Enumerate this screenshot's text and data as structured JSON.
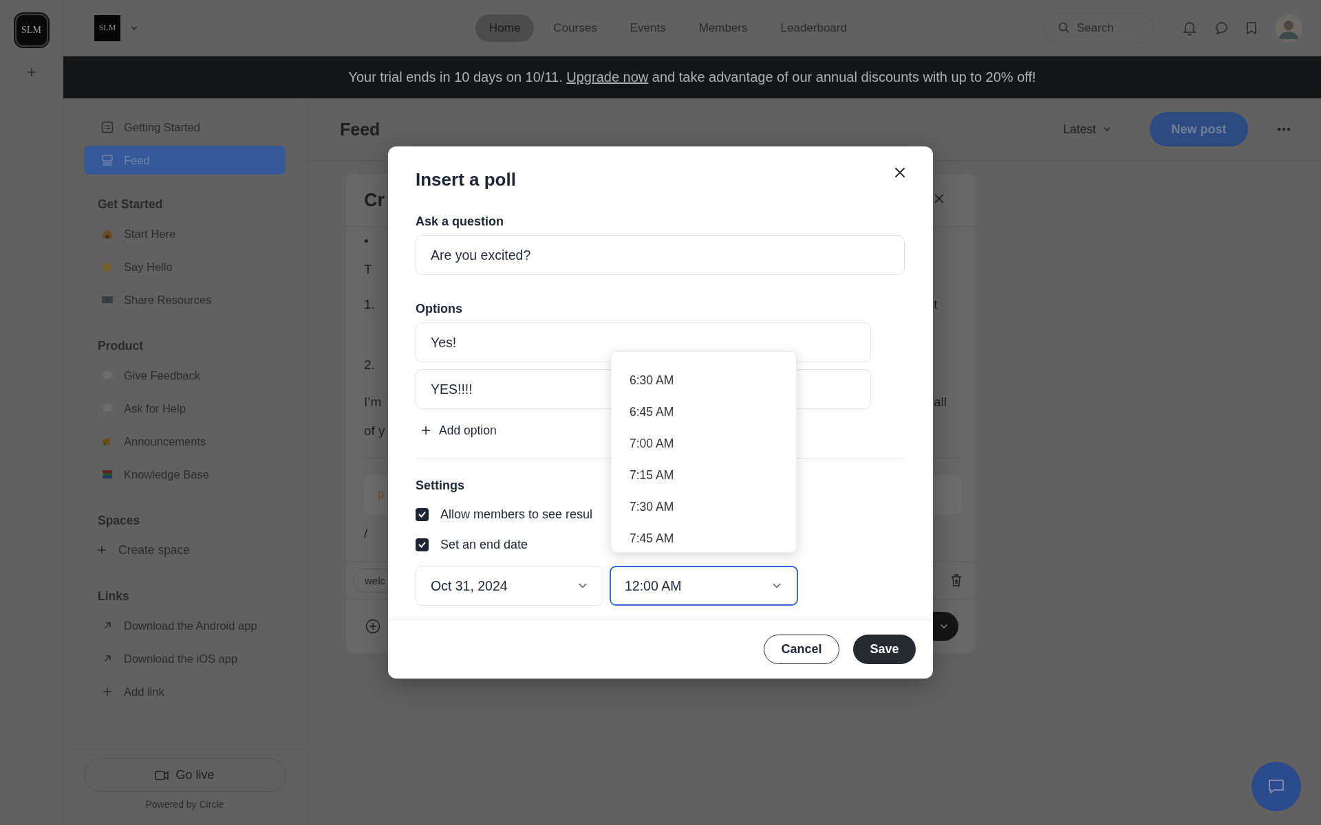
{
  "rail": {
    "logo": "SLM"
  },
  "header": {
    "logo": "SLM",
    "nav": [
      {
        "label": "Home",
        "selected": true
      },
      {
        "label": "Courses",
        "selected": false
      },
      {
        "label": "Events",
        "selected": false
      },
      {
        "label": "Members",
        "selected": false
      },
      {
        "label": "Leaderboard",
        "selected": false
      }
    ],
    "search": {
      "placeholder": "Search"
    }
  },
  "banner": {
    "before": "Your trial ends in 10 days on 10/11. ",
    "link": "Upgrade now",
    "after": " and take advantage of our annual discounts with up to 20% off!"
  },
  "sidebar": {
    "top_items": [
      {
        "label": "Getting Started",
        "selected": false
      },
      {
        "label": "Feed",
        "selected": true
      }
    ],
    "sections": [
      {
        "title": "Get Started",
        "items": [
          {
            "label": "Start Here",
            "kind": "space",
            "selected": false
          },
          {
            "label": "Say Hello",
            "kind": "space",
            "selected": false
          },
          {
            "label": "Share Resources",
            "kind": "space",
            "selected": false
          }
        ]
      },
      {
        "title": "Product",
        "items": [
          {
            "label": "Give Feedback",
            "kind": "space",
            "selected": false
          },
          {
            "label": "Ask for Help",
            "kind": "space",
            "selected": false
          },
          {
            "label": "Announcements",
            "kind": "space",
            "selected": false
          },
          {
            "label": "Knowledge Base",
            "kind": "space",
            "selected": false
          }
        ]
      },
      {
        "title": "Spaces",
        "items": [
          {
            "label": "Create space",
            "kind": "create",
            "selected": false
          }
        ]
      },
      {
        "title": "Links",
        "items": [
          {
            "label": "Download the Android app",
            "kind": "external",
            "selected": false
          },
          {
            "label": "Download the iOS app",
            "kind": "external",
            "selected": false
          },
          {
            "label": "Add link",
            "kind": "add",
            "selected": false
          }
        ]
      }
    ],
    "go_live": "Go live",
    "powered_by": "Powered by Circle"
  },
  "feed": {
    "title": "Feed",
    "sort": "Latest",
    "new_post": "New post"
  },
  "create_post": {
    "title": "Cr",
    "left_fragments": [
      "•",
      "T",
      "1.",
      "2.",
      "I’m",
      "of y"
    ],
    "right_fragments": [
      "t",
      "all"
    ],
    "code": "p",
    "slash": "/",
    "chip": "welc"
  },
  "poll": {
    "title": "Insert a poll",
    "question_label": "Ask a question",
    "question": "Are you excited?",
    "options_label": "Options",
    "options": [
      "Yes!",
      "YES!!!!"
    ],
    "add_option": "Add option",
    "settings_label": "Settings",
    "settings": [
      {
        "label": "Allow members to see resul",
        "checked": true
      },
      {
        "label": "Set an end date",
        "checked": true
      }
    ],
    "end_date": "Oct 31, 2024",
    "end_time": "12:00 AM",
    "time_options": [
      "6:30 AM",
      "6:45 AM",
      "7:00 AM",
      "7:15 AM",
      "7:30 AM",
      "7:45 AM"
    ],
    "cancel": "Cancel",
    "save": "Save"
  }
}
